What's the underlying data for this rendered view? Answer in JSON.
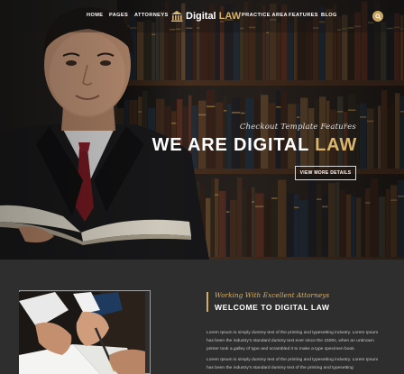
{
  "nav": {
    "left_items": [
      "HOME",
      "PAGES",
      "ATTORNEYS"
    ],
    "right_items": [
      "PRACTICE AREA",
      "FEATURES",
      "BLOG"
    ],
    "logo_text": "Digital",
    "logo_accent": "LAW",
    "search_icon": "search-icon"
  },
  "hero": {
    "subtitle": "Checkout Template Features",
    "title_main": "WE ARE DIGITAL",
    "title_accent": "LAW",
    "button_label": "VIEW MORE DETAILS"
  },
  "about": {
    "kicker": "Working With Excellent Attorneys",
    "title": "WELCOME TO DIGITAL LAW",
    "paragraph1": "Lorem Ipsum is simply dummy text of the printing and typesetting industry. Lorem Ipsum has been the industry's standard dummy text ever since the 1500s, when an unknown printer took a galley of type and scrambled it to make a type specimen book.",
    "paragraph2": "Lorem Ipsum is simply dummy text of the printing and typesetting industry. Lorem Ipsum has been the industry's standard dummy text of the printing and typesetting"
  },
  "colors": {
    "accent": "#d9b56d",
    "background_dark": "#2e2e2e"
  }
}
